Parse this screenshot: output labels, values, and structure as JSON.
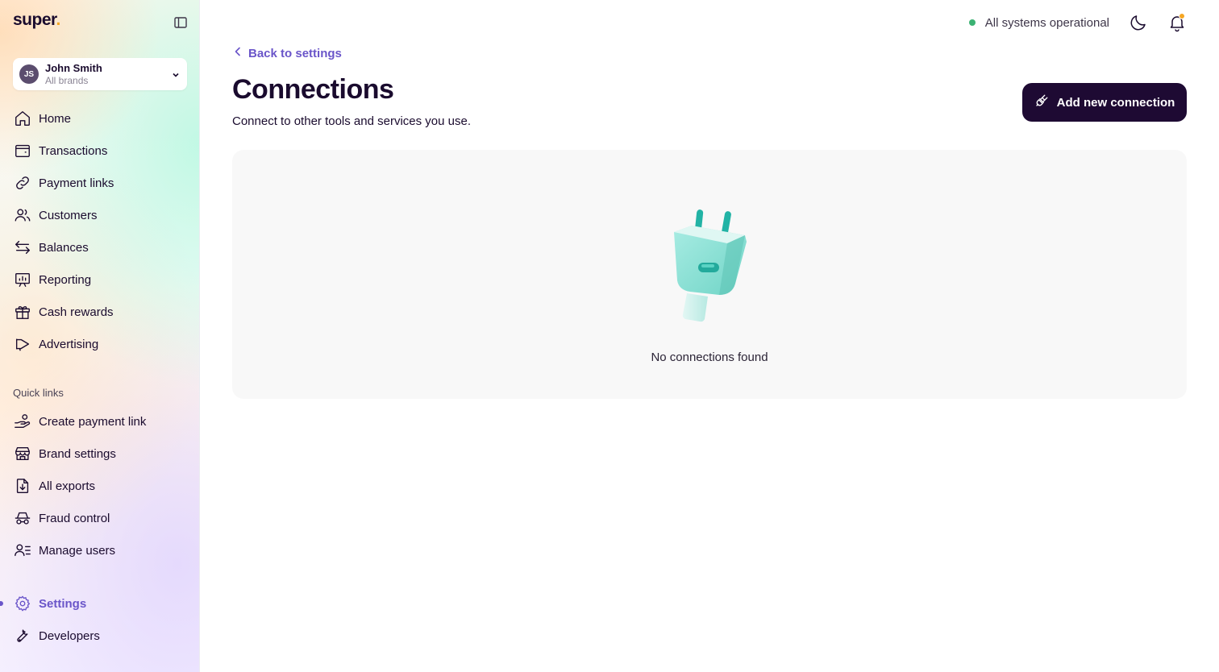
{
  "brand": {
    "logo_text": "super",
    "logo_dot": ".",
    "accent": "#6a55c9",
    "logo_accent": "#f5a623"
  },
  "user": {
    "initials": "JS",
    "name": "John Smith",
    "subtitle": "All brands"
  },
  "nav": [
    {
      "key": "home",
      "label": "Home",
      "icon": "home-icon"
    },
    {
      "key": "transactions",
      "label": "Transactions",
      "icon": "wallet-icon"
    },
    {
      "key": "payment-links",
      "label": "Payment links",
      "icon": "link-icon"
    },
    {
      "key": "customers",
      "label": "Customers",
      "icon": "users-icon"
    },
    {
      "key": "balances",
      "label": "Balances",
      "icon": "arrows-icon"
    },
    {
      "key": "reporting",
      "label": "Reporting",
      "icon": "presentation-chart-icon"
    },
    {
      "key": "cash-rewards",
      "label": "Cash rewards",
      "icon": "gift-icon"
    },
    {
      "key": "advertising",
      "label": "Advertising",
      "icon": "megaphone-icon"
    }
  ],
  "quick_links": {
    "title": "Quick links",
    "items": [
      {
        "key": "create-payment-link",
        "label": "Create payment link",
        "icon": "hand-coins-icon"
      },
      {
        "key": "brand-settings",
        "label": "Brand settings",
        "icon": "store-icon"
      },
      {
        "key": "all-exports",
        "label": "All exports",
        "icon": "file-download-icon"
      },
      {
        "key": "fraud-control",
        "label": "Fraud control",
        "icon": "incognito-icon"
      },
      {
        "key": "manage-users",
        "label": "Manage users",
        "icon": "user-list-icon"
      }
    ]
  },
  "bottom_nav": [
    {
      "key": "settings",
      "label": "Settings",
      "icon": "gear-icon",
      "active": true
    },
    {
      "key": "developers",
      "label": "Developers",
      "icon": "wrench-icon"
    }
  ],
  "topbar": {
    "status_text": "All systems operational",
    "status_color": "#3bb273",
    "notification_badge_color": "#f5a623"
  },
  "page": {
    "back_label": "Back to settings",
    "title": "Connections",
    "subtitle": "Connect to other tools and services you use.",
    "add_button_label": "Add new connection",
    "empty_text": "No connections found"
  }
}
